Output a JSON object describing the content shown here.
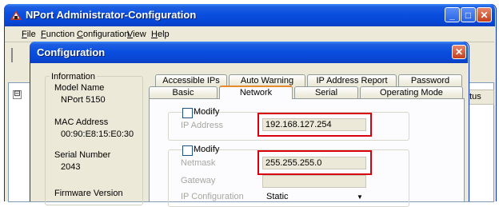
{
  "main_window": {
    "title": "NPort Administrator-Configuration",
    "menu": [
      {
        "underline": "F",
        "rest": "ile"
      },
      {
        "underline": "F",
        "rest": "unction"
      },
      {
        "underline": "C",
        "rest": "onfiguration"
      },
      {
        "underline": "V",
        "rest": "iew"
      },
      {
        "underline": "H",
        "rest": "elp"
      }
    ],
    "tree_expander": "⊟",
    "column_header_partial": "atus",
    "title_buttons": {
      "minimize": "_",
      "maximize": "□",
      "close": "✕"
    }
  },
  "dialog": {
    "title": "Configuration",
    "close": "✕",
    "info": {
      "group_title": "Information",
      "fields": [
        {
          "label": "Model Name",
          "value": "NPort 5150"
        },
        {
          "label": "MAC Address",
          "value": "00:90:E8:15:E0:30"
        },
        {
          "label": "Serial Number",
          "value": "2043"
        },
        {
          "label": "Firmware Version",
          "value": ""
        }
      ]
    },
    "tabs_row1": [
      "Accessible IPs",
      "Auto Warning",
      "IP Address Report",
      "Password"
    ],
    "tabs_row2": [
      "Basic",
      "Network",
      "Serial",
      "Operating Mode"
    ],
    "active_tab": "Network",
    "network": {
      "ip_group": {
        "modify_label": "Modify",
        "ip_label": "IP Address",
        "ip_value": "192.168.127.254"
      },
      "mask_group": {
        "modify_label": "Modify",
        "netmask_label": "Netmask",
        "netmask_value": "255.255.255.0",
        "gateway_label": "Gateway",
        "gateway_value": "",
        "ipconfig_label": "IP Configuration",
        "ipconfig_value": "Static",
        "ipconfig_arrow": "▼"
      }
    }
  },
  "colors": {
    "titlebar": "#0a4fe0",
    "window_face": "#ece9d8",
    "active_tab_accent": "#e68b2c",
    "highlight_box": "#d8000c"
  }
}
